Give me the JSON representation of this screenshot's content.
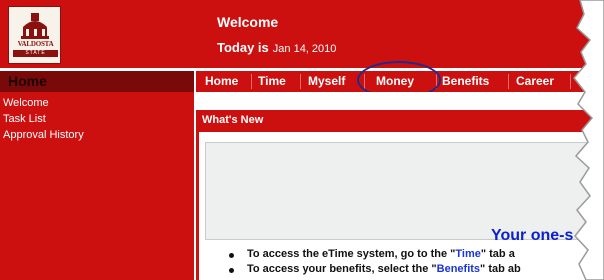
{
  "logo": {
    "name": "VALDOSTA",
    "subtitle": "STATE"
  },
  "header": {
    "welcome": "Welcome",
    "today_label": "Today is",
    "today_date": "Jan 14, 2010"
  },
  "sidebar": {
    "title": "Home",
    "items": [
      {
        "label": "Welcome"
      },
      {
        "label": "Task List"
      },
      {
        "label": "Approval History"
      }
    ]
  },
  "nav": {
    "tabs": [
      {
        "label": "Home"
      },
      {
        "label": "Time"
      },
      {
        "label": "Myself"
      },
      {
        "label": "Money"
      },
      {
        "label": "Benefits"
      },
      {
        "label": "Career"
      }
    ],
    "highlighted": "Money"
  },
  "content": {
    "section_title": "What's New",
    "banner_text": "Your one-s",
    "bullets": [
      {
        "pre": "To access the eTime system, go to the \"",
        "link": "Time",
        "post": "\" tab a"
      },
      {
        "pre": "To access your benefits, select the \"",
        "link": "Benefits",
        "post": "\" tab ab"
      }
    ]
  },
  "colors": {
    "brand_red": "#cc1010",
    "dark_red": "#7a0a0a",
    "highlight_oval": "#1f2a8a",
    "link_blue": "#1a35d6"
  }
}
